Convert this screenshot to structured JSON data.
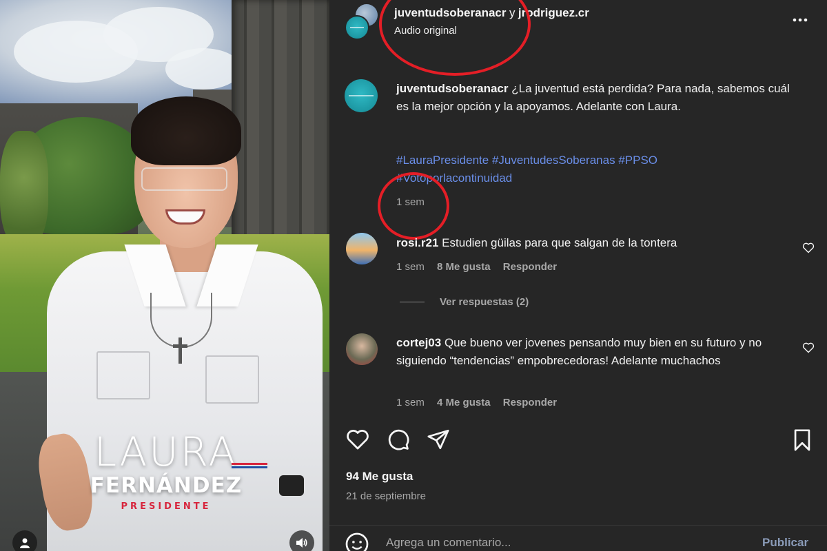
{
  "video": {
    "brand_first": "LAURA",
    "brand_last": "FERNÁNDEZ",
    "brand_role": "PRESIDENTE",
    "user_icon": "user-icon",
    "sound_icon": "speaker-icon"
  },
  "header": {
    "author_primary": "juventudsoberanacr",
    "joiner": "y",
    "author_secondary": "jrodriguez.cr",
    "subtitle": "Audio original",
    "more_icon": "more-dots-icon"
  },
  "caption": {
    "username": "juventudsoberanacr",
    "text": "¿La juventud está perdida? Para nada, sabemos cuál es la mejor opción y la apoyamos. Adelante con Laura.",
    "hashtags": [
      "#LauraPresidente",
      "#JuventudesSoberanas",
      "#PPSO",
      "#Votoporlacontinuidad"
    ],
    "time": "1 sem"
  },
  "comments": [
    {
      "username": "rosi.r21",
      "text": "Estudien güilas para que salgan de la tontera",
      "time": "1 sem",
      "likes": "8 Me gusta",
      "reply": "Responder",
      "view_replies": "Ver respuestas (2)"
    },
    {
      "username": "cortej03",
      "text": "Que bueno ver jovenes pensando muy bien en su futuro y no siguiendo “tendencias” empobrecedoras! Adelante muchachos",
      "time": "1 sem",
      "likes": "4 Me gusta",
      "reply": "Responder"
    }
  ],
  "actions": {
    "icons": [
      "heart-icon",
      "comment-icon",
      "share-icon",
      "bookmark-icon"
    ],
    "likes": "94 Me gusta",
    "date": "21 de septiembre"
  },
  "composer": {
    "placeholder": "Agrega un comentario...",
    "submit": "Publicar",
    "emoji_icon": "emoji-icon"
  },
  "colors": {
    "background": "#262626",
    "link": "#6a8ee8",
    "annotation_circle": "#e41e26"
  }
}
